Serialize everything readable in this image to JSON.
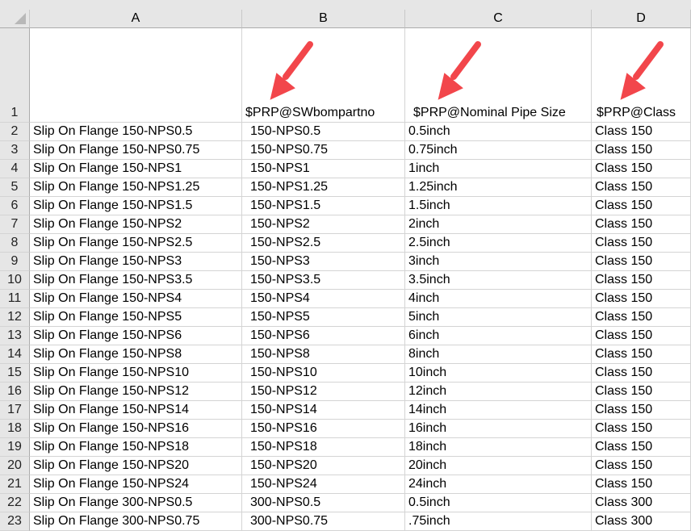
{
  "columns": [
    "A",
    "B",
    "C",
    "D"
  ],
  "header_row": {
    "num": "1",
    "A": "",
    "B": "$PRP@SWbompartno",
    "C": "$PRP@Nominal Pipe Size",
    "D": "$PRP@Class"
  },
  "rows": [
    {
      "num": "2",
      "A": "Slip On Flange 150-NPS0.5",
      "B": "150-NPS0.5",
      "C": "0.5inch",
      "D": "Class 150"
    },
    {
      "num": "3",
      "A": "Slip On Flange 150-NPS0.75",
      "B": "150-NPS0.75",
      "C": "0.75inch",
      "D": "Class 150"
    },
    {
      "num": "4",
      "A": "Slip On Flange 150-NPS1",
      "B": "150-NPS1",
      "C": "1inch",
      "D": "Class 150"
    },
    {
      "num": "5",
      "A": "Slip On Flange 150-NPS1.25",
      "B": "150-NPS1.25",
      "C": "1.25inch",
      "D": "Class 150"
    },
    {
      "num": "6",
      "A": "Slip On Flange 150-NPS1.5",
      "B": "150-NPS1.5",
      "C": "1.5inch",
      "D": "Class 150"
    },
    {
      "num": "7",
      "A": "Slip On Flange 150-NPS2",
      "B": "150-NPS2",
      "C": "2inch",
      "D": "Class 150"
    },
    {
      "num": "8",
      "A": "Slip On Flange 150-NPS2.5",
      "B": "150-NPS2.5",
      "C": "2.5inch",
      "D": "Class 150"
    },
    {
      "num": "9",
      "A": "Slip On Flange 150-NPS3",
      "B": "150-NPS3",
      "C": "3inch",
      "D": "Class 150"
    },
    {
      "num": "10",
      "A": "Slip On Flange 150-NPS3.5",
      "B": "150-NPS3.5",
      "C": "3.5inch",
      "D": "Class 150"
    },
    {
      "num": "11",
      "A": "Slip On Flange 150-NPS4",
      "B": "150-NPS4",
      "C": "4inch",
      "D": "Class 150"
    },
    {
      "num": "12",
      "A": "Slip On Flange 150-NPS5",
      "B": "150-NPS5",
      "C": "5inch",
      "D": "Class 150"
    },
    {
      "num": "13",
      "A": "Slip On Flange 150-NPS6",
      "B": "150-NPS6",
      "C": "6inch",
      "D": "Class 150"
    },
    {
      "num": "14",
      "A": "Slip On Flange 150-NPS8",
      "B": "150-NPS8",
      "C": "8inch",
      "D": "Class 150"
    },
    {
      "num": "15",
      "A": "Slip On Flange 150-NPS10",
      "B": "150-NPS10",
      "C": "10inch",
      "D": "Class 150"
    },
    {
      "num": "16",
      "A": "Slip On Flange 150-NPS12",
      "B": "150-NPS12",
      "C": "12inch",
      "D": "Class 150"
    },
    {
      "num": "17",
      "A": "Slip On Flange 150-NPS14",
      "B": "150-NPS14",
      "C": "14inch",
      "D": "Class 150"
    },
    {
      "num": "18",
      "A": "Slip On Flange 150-NPS16",
      "B": "150-NPS16",
      "C": "16inch",
      "D": "Class 150"
    },
    {
      "num": "19",
      "A": "Slip On Flange 150-NPS18",
      "B": "150-NPS18",
      "C": "18inch",
      "D": "Class 150"
    },
    {
      "num": "20",
      "A": "Slip On Flange 150-NPS20",
      "B": "150-NPS20",
      "C": "20inch",
      "D": "Class 150"
    },
    {
      "num": "21",
      "A": "Slip On Flange 150-NPS24",
      "B": "150-NPS24",
      "C": "24inch",
      "D": "Class 150"
    },
    {
      "num": "22",
      "A": "Slip On Flange 300-NPS0.5",
      "B": "300-NPS0.5",
      "C": "0.5inch",
      "D": "Class 300"
    },
    {
      "num": "23",
      "A": "Slip On Flange 300-NPS0.75",
      "B": "300-NPS0.75",
      "C": ".75inch",
      "D": "Class 300"
    }
  ],
  "arrow_color": "#f2464b"
}
